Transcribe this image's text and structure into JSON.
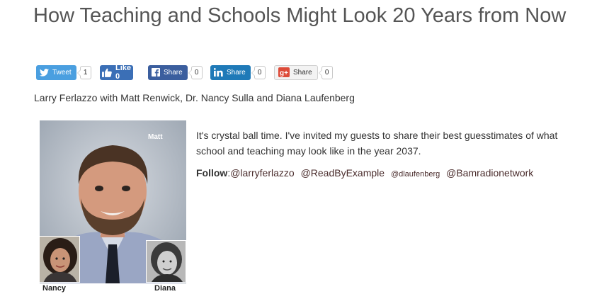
{
  "article": {
    "title": "How Teaching and Schools Might Look 20 Years from Now",
    "byline": "Larry Ferlazzo with Matt Renwick, Dr. Nancy Sulla and Diana Laufenberg",
    "intro": "It's crystal ball time. I've invited my guests to share their best guesstimates of what school and teaching may look like in the year 2037."
  },
  "share": {
    "tweet_label": "Tweet",
    "tweet_count": "1",
    "like_label": "Like 0",
    "fb_share_label": "Share",
    "fb_share_count": "0",
    "li_share_label": "Share",
    "li_share_count": "0",
    "gp_share_label": "Share",
    "gp_share_count": "0"
  },
  "photo": {
    "main_label": "Matt",
    "left_caption": "Nancy",
    "right_caption": "Diana"
  },
  "follow": {
    "label": "Follow",
    "handles": [
      "@larryferlazzo",
      "@ReadByExample",
      "@dlaufenberg",
      "@Bamradionetwork"
    ]
  },
  "colors": {
    "twitter": "#4a9fe0",
    "facebook": "#3b5e9e",
    "linkedin": "#1f7ab8",
    "google_plus": "#dd4b39"
  },
  "icons": [
    "twitter-bird-icon",
    "thumbs-up-icon",
    "facebook-icon",
    "linkedin-icon",
    "google-plus-icon"
  ]
}
